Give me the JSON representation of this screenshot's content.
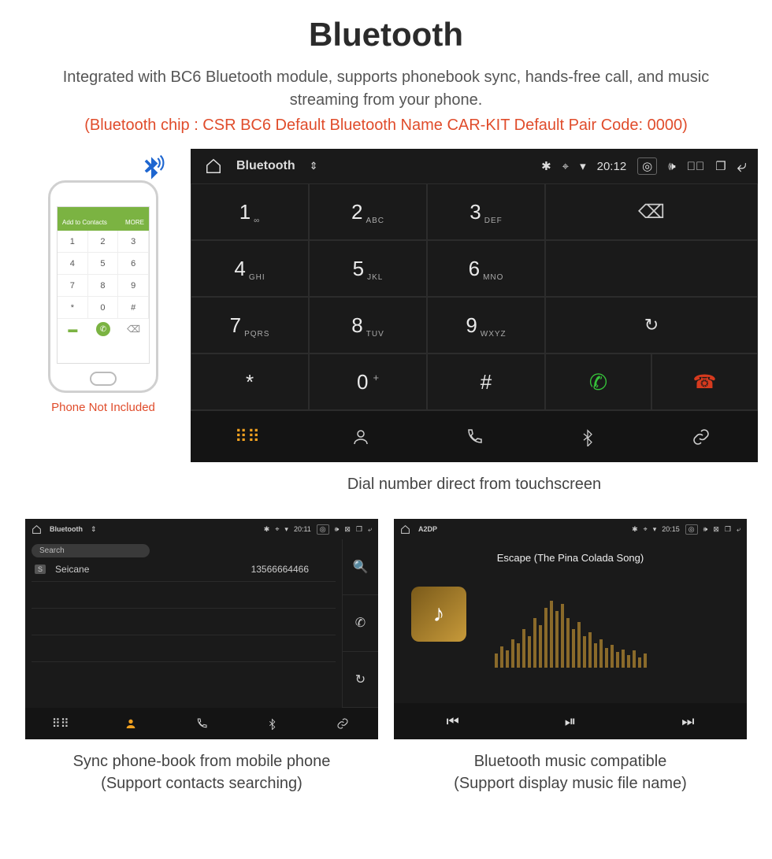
{
  "header": {
    "title": "Bluetooth",
    "subtitle": "Integrated with BC6 Bluetooth module, supports phonebook sync, hands-free call, and music streaming from your phone.",
    "spec": "(Bluetooth chip : CSR BC6     Default Bluetooth Name CAR-KIT     Default Pair Code: 0000)"
  },
  "phone": {
    "caption": "Phone Not Included",
    "bar_label": "Add to Contacts",
    "bar_right": "MORE",
    "keys": [
      "1",
      "2",
      "3",
      "4",
      "5",
      "6",
      "7",
      "8",
      "9",
      "*",
      "0",
      "#"
    ]
  },
  "dialer_unit": {
    "status": {
      "app_title": "Bluetooth",
      "time": "20:12"
    },
    "keys": [
      {
        "num": "1",
        "sub": "∞"
      },
      {
        "num": "2",
        "sub": "ABC"
      },
      {
        "num": "3",
        "sub": "DEF"
      },
      {
        "num": "4",
        "sub": "GHI"
      },
      {
        "num": "5",
        "sub": "JKL"
      },
      {
        "num": "6",
        "sub": "MNO"
      },
      {
        "num": "7",
        "sub": "PQRS"
      },
      {
        "num": "8",
        "sub": "TUV"
      },
      {
        "num": "9",
        "sub": "WXYZ"
      },
      {
        "num": "*",
        "sub": ""
      },
      {
        "num": "0",
        "sub": "+",
        "supAfter": true
      },
      {
        "num": "#",
        "sub": ""
      }
    ],
    "caption": "Dial number direct from touchscreen"
  },
  "contacts_unit": {
    "status": {
      "app_title": "Bluetooth",
      "time": "20:11"
    },
    "search_placeholder": "Search",
    "contact": {
      "initial": "S",
      "name": "Seicane",
      "number": "13566664466"
    },
    "caption_line1": "Sync phone-book from mobile phone",
    "caption_line2": "(Support contacts searching)"
  },
  "music_unit": {
    "status": {
      "app_title": "A2DP",
      "time": "20:15"
    },
    "track_title": "Escape (The Pina Colada Song)",
    "caption_line1": "Bluetooth music compatible",
    "caption_line2": "(Support display music file name)"
  }
}
